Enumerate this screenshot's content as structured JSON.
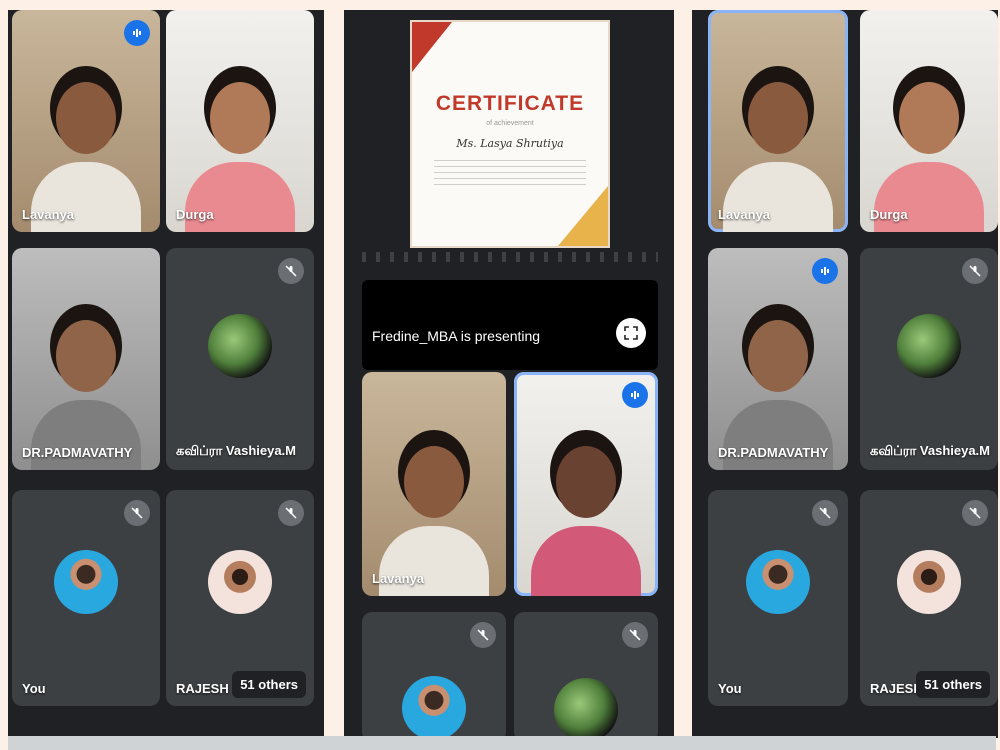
{
  "screenshots": [
    {
      "tiles": [
        {
          "name": "Lavanya",
          "kind": "video"
        },
        {
          "name": "Durga",
          "kind": "video"
        },
        {
          "name": "DR.PADMAVATHY",
          "kind": "video"
        },
        {
          "name": "கவிப்ரா Vashieya.M",
          "kind": "avatar"
        },
        {
          "name": "You",
          "kind": "avatar"
        },
        {
          "name": "RAJESH",
          "kind": "avatar",
          "others": "51 others"
        }
      ]
    },
    {
      "certificate": {
        "title": "CERTIFICATE",
        "subtitle": "of achievement",
        "recipient": "Ms. Lasya Shrutiya"
      },
      "presenting_text": "Fredine_MBA is presenting",
      "tiles": [
        {
          "name": "Lavanya",
          "kind": "video"
        },
        {
          "name": "",
          "kind": "video"
        }
      ]
    },
    {
      "tiles": [
        {
          "name": "Lavanya",
          "kind": "video"
        },
        {
          "name": "Durga",
          "kind": "video"
        },
        {
          "name": "DR.PADMAVATHY",
          "kind": "video"
        },
        {
          "name": "கவிப்ரா Vashieya.M",
          "kind": "avatar"
        },
        {
          "name": "You",
          "kind": "avatar"
        },
        {
          "name": "RAJESH",
          "kind": "avatar",
          "others": "51 others"
        }
      ]
    }
  ],
  "icons": {
    "mute": "mic-off-icon",
    "speaking": "speaking-icon",
    "fullscreen": "fullscreen-icon"
  },
  "colors": {
    "accent": "#1a73e8",
    "tile": "#3c4043",
    "background": "#202124"
  }
}
